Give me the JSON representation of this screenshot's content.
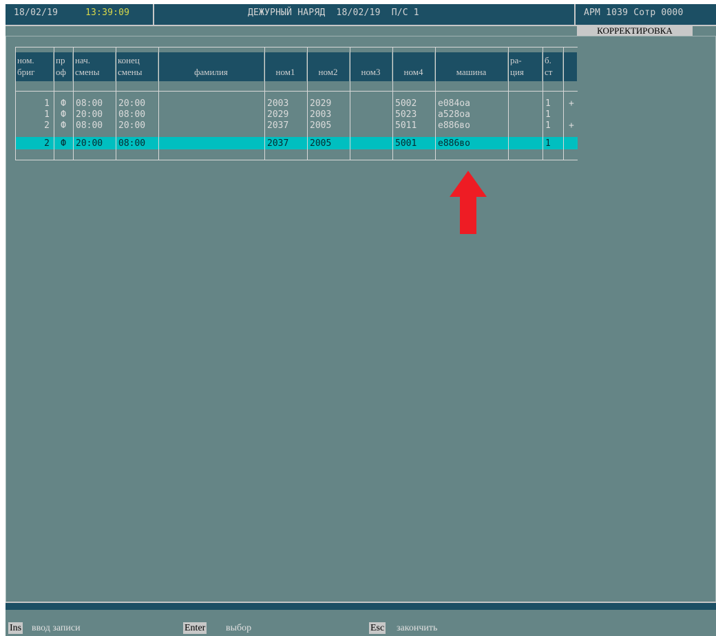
{
  "topbar": {
    "date": "18/02/19",
    "time": "13:39:09",
    "title": "ДЕЖУРНЫЙ НАРЯД  18/02/19  П/С 1",
    "user": "АРМ 1039 Сотр 0000",
    "mode": "КОРРЕКТИРОВКА"
  },
  "columns": [
    {
      "l1": "ном.",
      "l2": "бриг"
    },
    {
      "l1": "пр",
      "l2": "оф"
    },
    {
      "l1": "нач.",
      "l2": "смены"
    },
    {
      "l1": "конец",
      "l2": "смены"
    },
    {
      "l1": "",
      "l2": "фамилия"
    },
    {
      "l1": "",
      "l2": "ном1"
    },
    {
      "l1": "",
      "l2": "ном2"
    },
    {
      "l1": "",
      "l2": "ном3"
    },
    {
      "l1": "",
      "l2": "ном4"
    },
    {
      "l1": "",
      "l2": "машина"
    },
    {
      "l1": "ра-",
      "l2": "ция"
    },
    {
      "l1": "б.",
      "l2": "ст"
    }
  ],
  "rows": [
    {
      "brig": "1",
      "prof": "Ф",
      "start": "08:00",
      "end": "20:00",
      "name": "",
      "nom1": "2003",
      "nom2": "2029",
      "nom3": "",
      "nom4": "5002",
      "car": "е084оа",
      "radio": "",
      "bst": "1",
      "mark": "+"
    },
    {
      "brig": "1",
      "prof": "Ф",
      "start": "20:00",
      "end": "08:00",
      "name": "",
      "nom1": "2029",
      "nom2": "2003",
      "nom3": "",
      "nom4": "5023",
      "car": "а528оа",
      "radio": "",
      "bst": "1",
      "mark": ""
    },
    {
      "brig": "2",
      "prof": "Ф",
      "start": "08:00",
      "end": "20:00",
      "name": "",
      "nom1": "2037",
      "nom2": "2005",
      "nom3": "",
      "nom4": "5011",
      "car": "е886во",
      "radio": "",
      "bst": "1",
      "mark": "+"
    },
    {
      "brig": "2",
      "prof": "Ф",
      "start": "20:00",
      "end": "08:00",
      "name": "",
      "nom1": "2037",
      "nom2": "2005",
      "nom3": "",
      "nom4": "5001",
      "car": "е886во",
      "radio": "",
      "bst": "1",
      "mark": ""
    }
  ],
  "selected_row": 3,
  "footer": {
    "ins_key": "Ins",
    "ins_label": "ввод записи",
    "enter_key": "Enter",
    "enter_label": "выбор",
    "esc_key": "Esc",
    "esc_label": "закончить"
  },
  "colors": {
    "background": "#658586",
    "bar": "#1c4f64",
    "selection": "#00bfc0",
    "clock": "#d8d84a",
    "arrow": "#ee1c24"
  }
}
